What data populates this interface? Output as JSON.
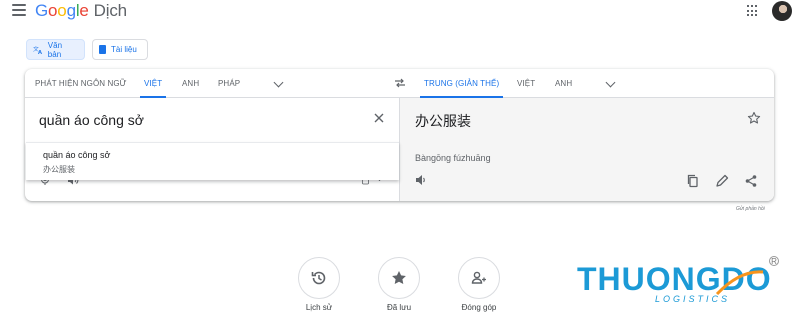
{
  "app": {
    "logo_letters": [
      "G",
      "o",
      "o",
      "g",
      "l",
      "e"
    ],
    "product": "Dịch",
    "icons": {
      "menu": "hamburger-menu-icon",
      "apps": "apps-grid-icon",
      "avatar": "user-avatar"
    }
  },
  "modes": {
    "text_label": "Văn bản",
    "docs_label": "Tài liệu"
  },
  "source_langs": {
    "detect": "Phát hiện ngôn ngữ",
    "lang1": "Việt",
    "lang2": "Anh",
    "lang3": "Pháp"
  },
  "target_langs": {
    "lang1": "Trung (Giản thể)",
    "lang2": "Việt",
    "lang3": "Anh"
  },
  "source": {
    "text": "quần áo công sở",
    "char_count": "15 / 5000"
  },
  "suggestion": {
    "main": "quần áo công sở",
    "sub": "办公服装"
  },
  "target": {
    "text": "办公服装",
    "transliteration": "Bàngōng fúzhuāng"
  },
  "feedback": "Gửi phản hồi",
  "bottom": {
    "history": "Lịch sử",
    "saved": "Đã lưu",
    "contribute": "Đóng góp"
  },
  "watermark": {
    "name": "THUONGDO",
    "sub": "LOGISTICS",
    "reg": "R"
  },
  "colors": {
    "accent": "#1a73e8",
    "active_bg": "#e8f0fe",
    "target_bg": "#f5f5f5",
    "watermark": "#1c9ad6"
  }
}
